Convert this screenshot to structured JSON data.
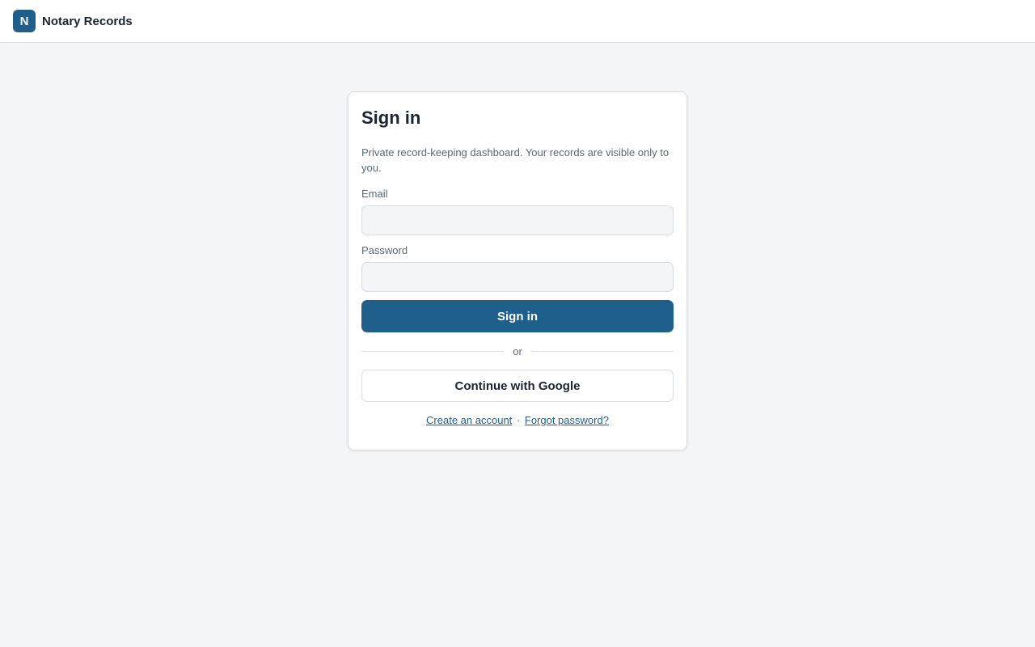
{
  "header": {
    "logo_letter": "N",
    "app_name": "Notary Records"
  },
  "signin": {
    "title": "Sign in",
    "description": "Private record-keeping dashboard. Your records are visible only to you.",
    "email_label": "Email",
    "email_value": "",
    "password_label": "Password",
    "password_value": "",
    "submit_label": "Sign in",
    "divider_text": "or",
    "google_label": "Continue with Google",
    "create_account_link": "Create an account",
    "link_separator": "·",
    "forgot_password_link": "Forgot password?"
  },
  "colors": {
    "brand": "#1f5f8b",
    "background": "#f3f5f7",
    "text_primary": "#1b2430",
    "text_muted": "#5b6875"
  }
}
